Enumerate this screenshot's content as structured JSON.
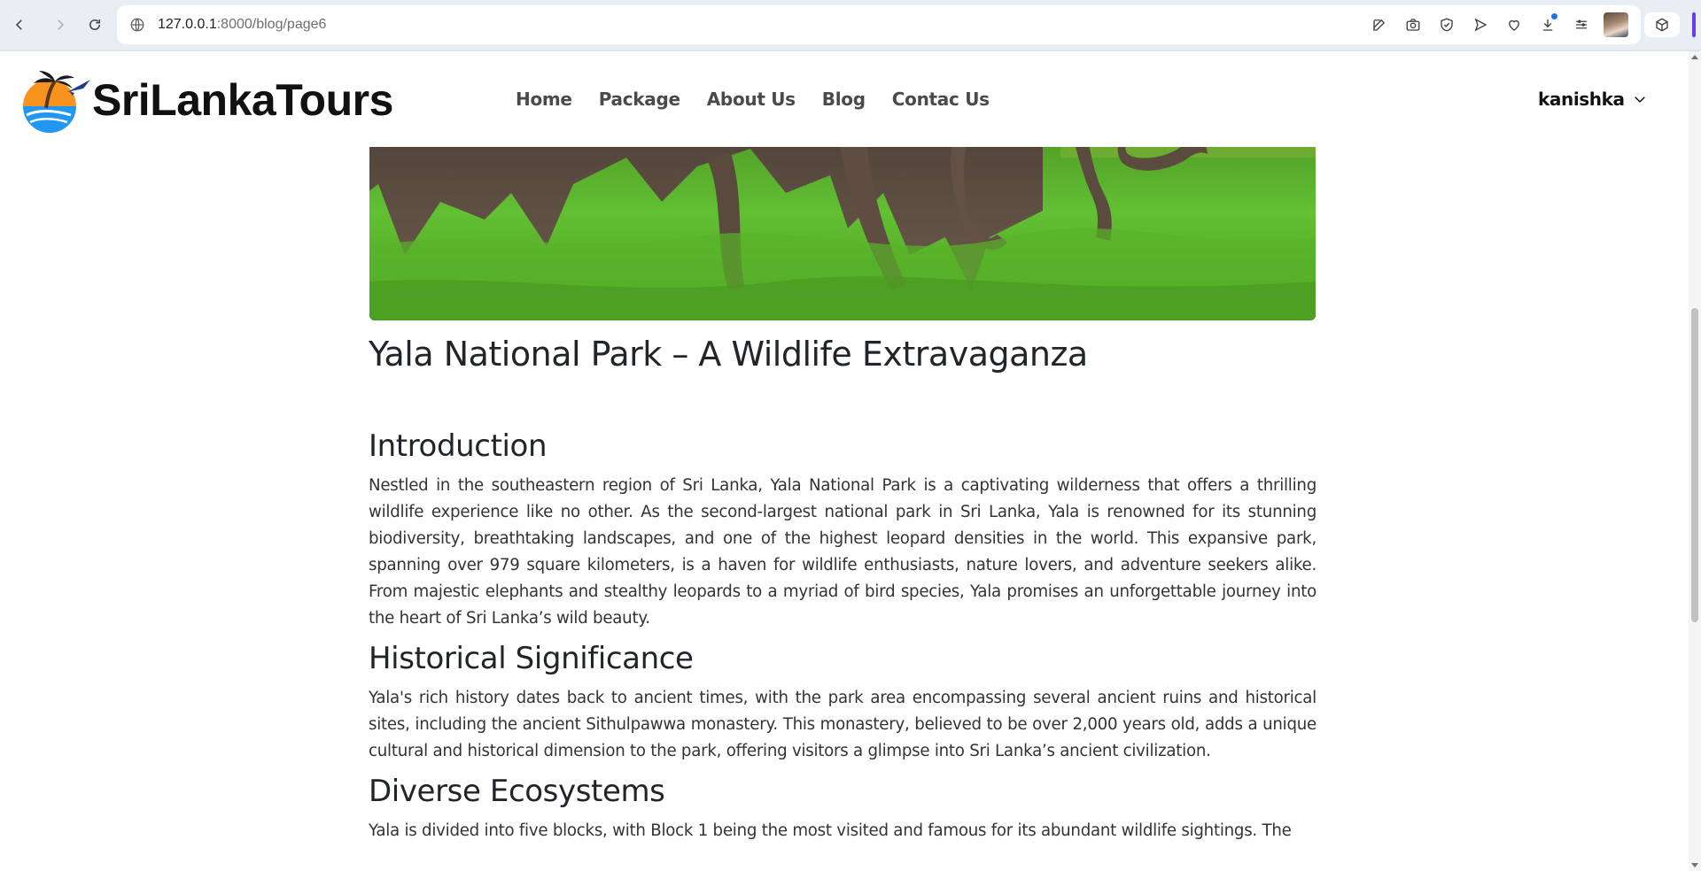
{
  "browser": {
    "url_host": "127.0.0.1",
    "url_rest": ":8000/blog/page6",
    "icons": [
      "back-icon",
      "forward-icon",
      "reload-icon",
      "site-info-icon",
      "edit-icon",
      "camera-icon",
      "shield-check-icon",
      "send-icon",
      "heart-icon",
      "download-icon",
      "menu-icon",
      "profile-avatar",
      "extensions-icon"
    ]
  },
  "header": {
    "brand": "SriLankaTours",
    "nav": [
      "Home",
      "Package",
      "About Us",
      "Blog",
      "Contac Us"
    ],
    "user": "kanishka"
  },
  "article": {
    "title": "Yala National Park – A Wildlife Extravaganza",
    "sections": [
      {
        "heading": "Introduction",
        "body": "Nestled in the southeastern region of Sri Lanka, Yala National Park is a captivating wilderness that offers a thrilling wildlife experience like no other. As the second-largest national park in Sri Lanka, Yala is renowned for its stunning biodiversity, breathtaking landscapes, and one of the highest leopard densities in the world. This expansive park, spanning over 979 square kilometers, is a haven for wildlife enthusiasts, nature lovers, and adventure seekers alike. From majestic elephants and stealthy leopards to a myriad of bird species, Yala promises an unforgettable journey into the heart of Sri Lanka’s wild beauty."
      },
      {
        "heading": "Historical Significance",
        "body": "Yala's rich history dates back to ancient times, with the park area encompassing several ancient ruins and historical sites, including the ancient Sithulpawwa monastery. This monastery, believed to be over 2,000 years old, adds a unique cultural and historical dimension to the park, offering visitors a glimpse into Sri Lanka’s ancient civilization."
      },
      {
        "heading": "Diverse Ecosystems",
        "body": "Yala is divided into five blocks, with Block 1 being the most visited and famous for its abundant wildlife sightings. The"
      }
    ]
  },
  "colors": {
    "accent": "#6a3cf0",
    "text": "#212529",
    "grass": "#5fbf2e"
  }
}
